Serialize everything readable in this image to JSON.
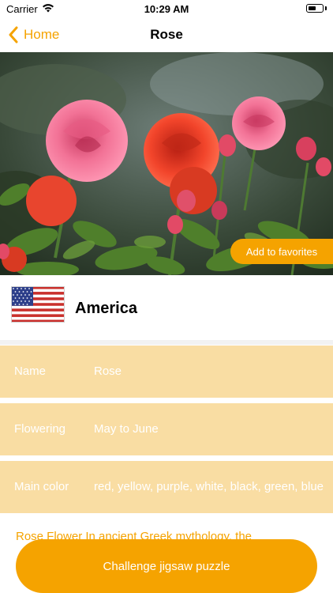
{
  "status_bar": {
    "carrier": "Carrier",
    "time": "10:29 AM"
  },
  "navbar": {
    "back_label": "Home",
    "title": "Rose"
  },
  "hero": {
    "favorite_button": "Add to favorites"
  },
  "country": {
    "name": "America"
  },
  "info": {
    "rows": [
      {
        "label": "Name",
        "value": "Rose"
      },
      {
        "label": "Flowering",
        "value": "May to June"
      },
      {
        "label": "Main color",
        "value": "red, yellow, purple, white, black, green, blue"
      }
    ]
  },
  "description": "Rose Flower In ancient Greek mythology, the",
  "actions": {
    "challenge_button": "Challenge jigsaw puzzle"
  },
  "colors": {
    "accent": "#f5a300",
    "info_row_bg": "#f9dda3"
  },
  "icons": {
    "back": "chevron-left-icon",
    "wifi": "wifi-icon",
    "battery": "battery-icon",
    "flag": "us-flag"
  }
}
